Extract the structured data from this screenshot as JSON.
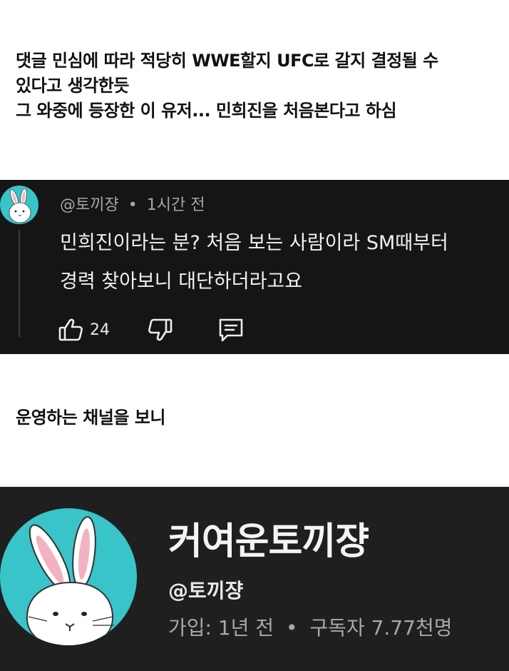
{
  "caption_top": {
    "lines": [
      "댓글 민심에 따라 적당히 WWE할지 UFC로 갈지 결정될 수",
      "있다고 생각한듯",
      "그 와중에 등장한 이 유저... 민희진을 처음본다고 하심"
    ]
  },
  "comment": {
    "handle": "@토끼쟝",
    "separator": "•",
    "time": "1시간 전",
    "body_lines": [
      "민희진이라는 분? 처음 보는 사람이라 SM때부터",
      "경력 찾아보니 대단하더라고요"
    ],
    "like_count": "24",
    "icons": {
      "avatar": "rabbit-avatar-icon",
      "like": "thumbs-up-icon",
      "dislike": "thumbs-down-icon",
      "reply": "comment-reply-icon"
    }
  },
  "caption_mid": {
    "lines": [
      "운영하는 채널을 보니"
    ]
  },
  "channel": {
    "name": "커여운토끼쟝",
    "handle": "@토끼쟝",
    "joined": "가입: 1년 전",
    "separator": "•",
    "subscribers": "구독자 7.77천명"
  },
  "colors": {
    "avatar_bg": "#38c4c8",
    "comment_bg": "#151515",
    "channel_bg": "#1f1f1f"
  }
}
